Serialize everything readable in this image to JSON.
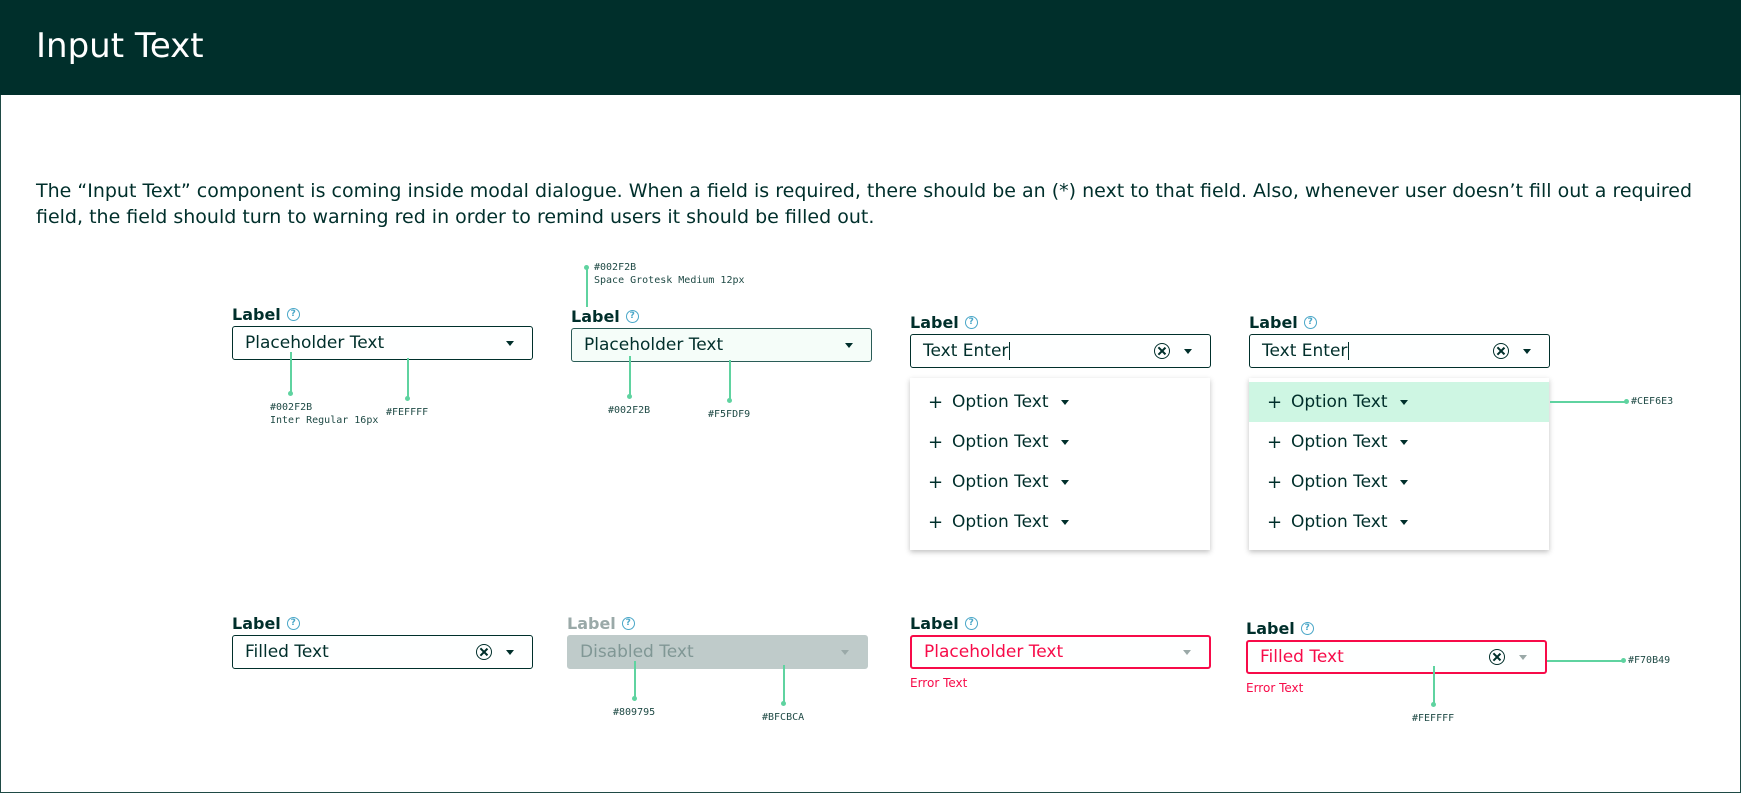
{
  "header": {
    "title": "Input Text"
  },
  "description": "The “Input Text” component is coming inside modal dialogue. When a field is required, there should be an (*) next to that field. Also, whenever user doesn’t fill out a required field, the field should turn to warning red in order to remind users it should be filled out.",
  "colors": {
    "primary": "#002F2B",
    "white": "#FEFFFF",
    "light_bg": "#F5FDF9",
    "highlight": "#CEF6E3",
    "disabled_text": "#809795",
    "disabled_bg": "#BFCBCA",
    "error": "#F70B49"
  },
  "fields": {
    "default": {
      "label": "Label",
      "text": "Placeholder Text"
    },
    "hover": {
      "label": "Label",
      "text": "Placeholder Text"
    },
    "open": {
      "label": "Label",
      "text": "Text Enter"
    },
    "open_highlight": {
      "label": "Label",
      "text": "Text Enter"
    },
    "filled": {
      "label": "Label",
      "text": "Filled Text"
    },
    "disabled": {
      "label": "Label",
      "text": "Disabled Text"
    },
    "error_placeholder": {
      "label": "Label",
      "text": "Placeholder Text",
      "error": "Error Text"
    },
    "error_filled": {
      "label": "Label",
      "text": "Filled Text",
      "error": "Error Text"
    }
  },
  "dropdown": {
    "options": [
      "Option Text",
      "Option Text",
      "Option Text",
      "Option Text"
    ]
  },
  "annotations": {
    "a1": {
      "color": "#002F2B",
      "font": "Inter Regular 16px"
    },
    "a2": {
      "color": "#FEFFFF"
    },
    "a3": {
      "color": "#002F2B",
      "font": "Space Grotesk Medium 12px"
    },
    "a4": {
      "color": "#002F2B"
    },
    "a5": {
      "color": "#F5FDF9"
    },
    "a6": {
      "color": "#CEF6E3"
    },
    "a7": {
      "color": "#809795"
    },
    "a8": {
      "color": "#BFCBCA"
    },
    "a9": {
      "color": "#F70B49"
    },
    "a10": {
      "color": "#FEFFFF"
    }
  }
}
